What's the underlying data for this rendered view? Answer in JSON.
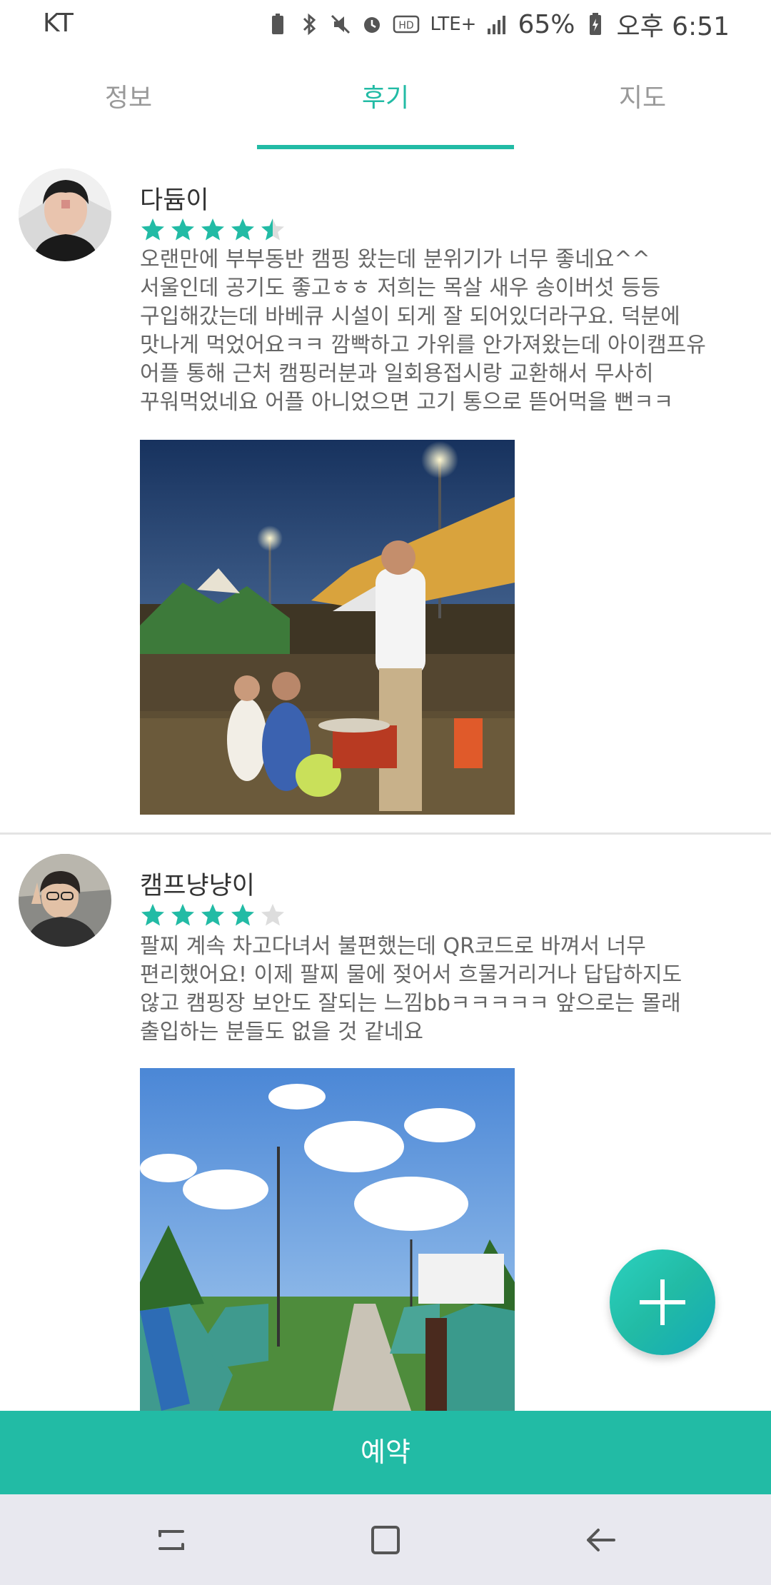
{
  "status_bar": {
    "carrier": "KT",
    "network": "LTE+",
    "battery": "65%",
    "time": "오후 6:51",
    "icons": [
      "battery-saver-icon",
      "bluetooth-icon",
      "mute-icon",
      "alarm-icon",
      "hd-icon",
      "signal-icon",
      "battery-icon"
    ]
  },
  "tabs": [
    {
      "label": "정보",
      "active": false
    },
    {
      "label": "후기",
      "active": true
    },
    {
      "label": "지도",
      "active": false
    }
  ],
  "reviews": [
    {
      "name": "다듐이",
      "rating": 4.5,
      "text": "오랜만에 부부동반 캠핑 왔는데 분위기가 너무 좋네요^^\n서울인데 공기도 좋고ㅎㅎ 저희는 목살 새우 송이버섯 등등\n구입해갔는데 바베큐 시설이 되게 잘 되어있더라구요.  덕분에\n맛나게 먹었어요ㅋㅋ 깜빡하고 가위를 안가져왔는데 아이캠프유\n어플 통해 근처 캠핑러분과 일회용접시랑 교환해서 무사히\n꾸워먹었네요 어플 아니었으면 고기 통으로 뜯어먹을 뻔ㅋㅋ",
      "photo": "night-campsite-bbq-photo"
    },
    {
      "name": "캠프냥냥이",
      "rating": 4,
      "text": "팔찌 계속 차고다녀서 불편했는데 QR코드로 바껴서 너무\n편리했어요! 이제 팔찌 물에 젖어서 흐물거리거나 답답하지도\n않고 캠핑장 보안도 잘되는 느낌bbㅋㅋㅋㅋㅋ 앞으로는 몰래\n출입하는 분들도 없을 것 같네요",
      "photo": "daytime-campsite-tents-photo"
    }
  ],
  "fab": {
    "icon": "plus-icon"
  },
  "reserve_button": {
    "label": "예약"
  },
  "nav_bar": {
    "icons": [
      "recents-icon",
      "home-icon",
      "back-icon"
    ]
  },
  "colors": {
    "accent": "#22bba5",
    "star_empty": "#dddddd",
    "navbar_bg": "#e8e8ef"
  }
}
